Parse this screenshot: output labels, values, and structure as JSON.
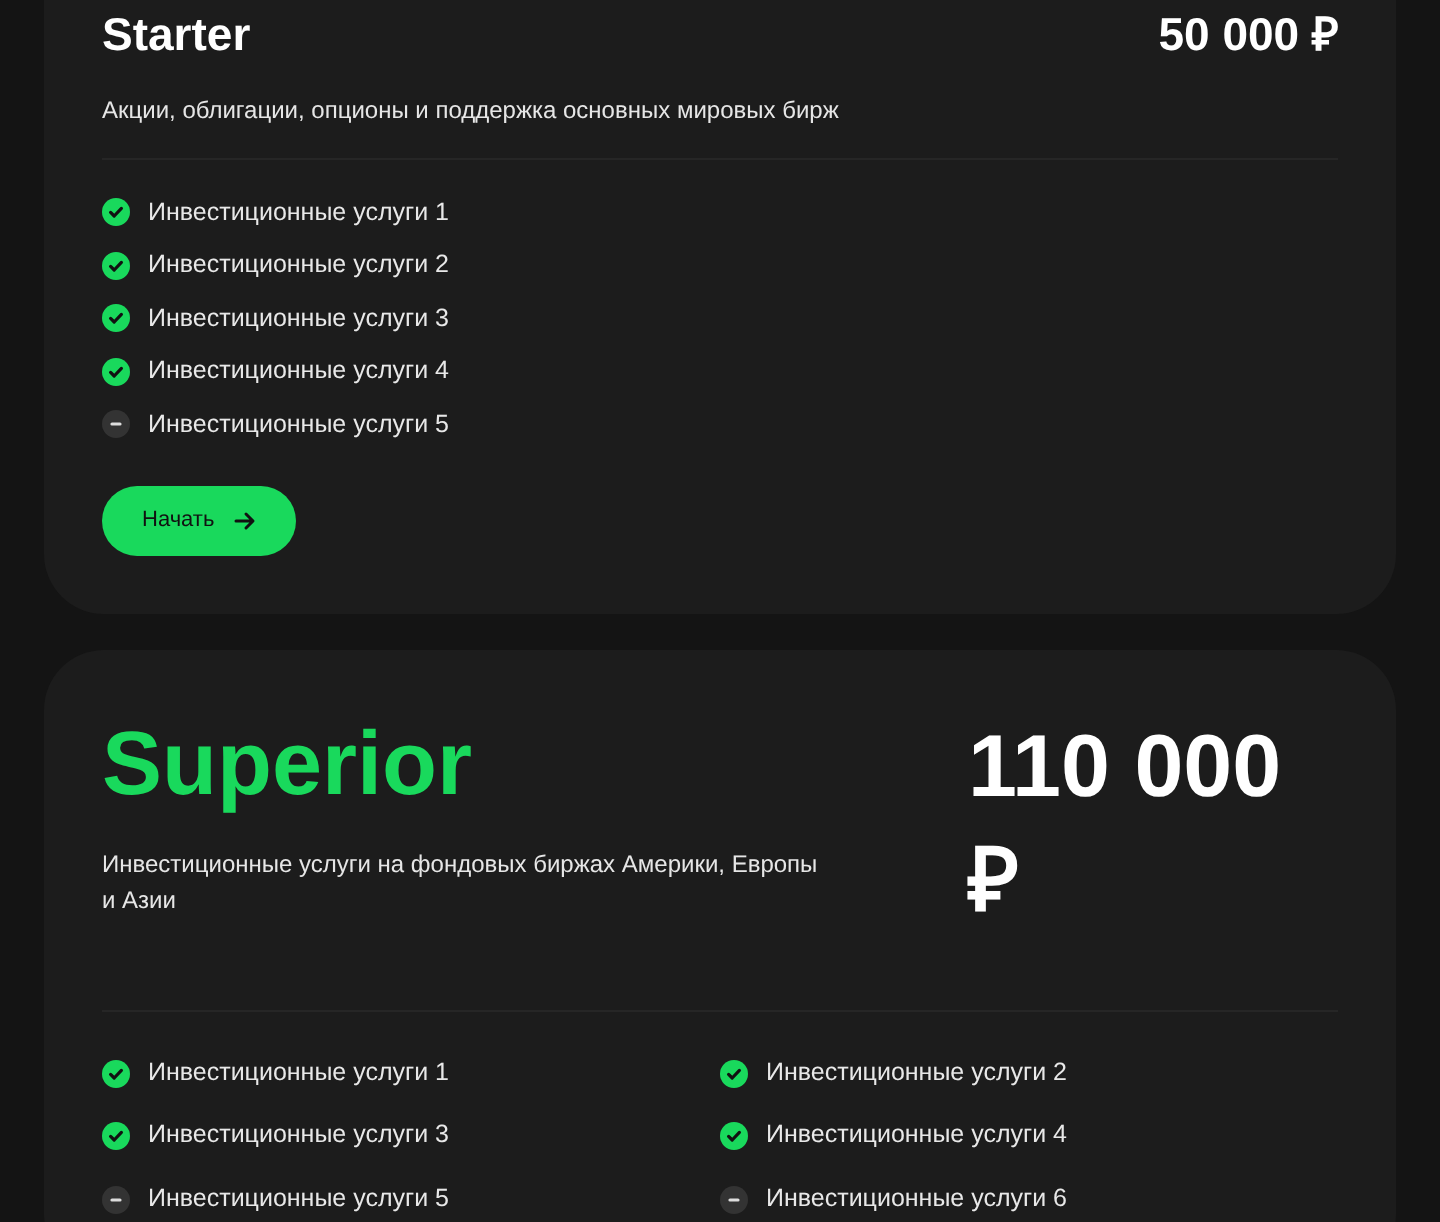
{
  "plans": [
    {
      "kind": "basic",
      "name": "Starter",
      "highlighted": false,
      "price": "50 000 ₽",
      "description": "Акции, облигации, опционы и поддержка основных мировых бирж",
      "features": [
        {
          "label": "Инвестиционные услуги 1",
          "included": true
        },
        {
          "label": "Инвестиционные услуги 2",
          "included": true
        },
        {
          "label": "Инвестиционные услуги 3",
          "included": true
        },
        {
          "label": "Инвестиционные услуги 4",
          "included": true
        },
        {
          "label": "Инвестиционные услуги 5",
          "included": false
        }
      ],
      "button": "Начать"
    },
    {
      "kind": "featured",
      "name": "Superior",
      "highlighted": true,
      "price": "110 000 ₽",
      "description": "Инвестиционные услуги на фондовых биржах Америки, Европы и Азии",
      "features": [
        {
          "label": "Инвестиционные услуги 1",
          "included": true
        },
        {
          "label": "Инвестиционные услуги 2",
          "included": true
        },
        {
          "label": "Инвестиционные услуги 3",
          "included": true
        },
        {
          "label": "Инвестиционные услуги 4",
          "included": true
        },
        {
          "label": "Инвестиционные услуги 5",
          "included": false
        },
        {
          "label": "Инвестиционные услуги 6",
          "included": false
        }
      ]
    }
  ]
}
